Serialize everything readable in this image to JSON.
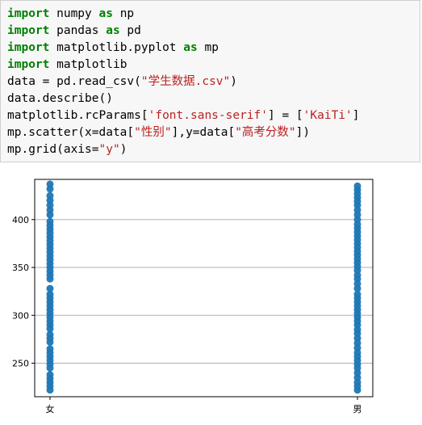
{
  "code_cell": {
    "lines": [
      [
        {
          "t": "import",
          "c": "kw"
        },
        {
          "t": " numpy "
        },
        {
          "t": "as",
          "c": "kw"
        },
        {
          "t": " np"
        }
      ],
      [
        {
          "t": "import",
          "c": "kw"
        },
        {
          "t": " pandas "
        },
        {
          "t": "as",
          "c": "kw"
        },
        {
          "t": " pd"
        }
      ],
      [
        {
          "t": "import",
          "c": "kw"
        },
        {
          "t": " matplotlib.pyplot "
        },
        {
          "t": "as",
          "c": "kw"
        },
        {
          "t": " mp"
        }
      ],
      [
        {
          "t": "import",
          "c": "kw"
        },
        {
          "t": " matplotlib"
        }
      ],
      [
        {
          "t": "data = pd.read_csv("
        },
        {
          "t": "\"学生数据.csv\"",
          "c": "str"
        },
        {
          "t": ")"
        }
      ],
      [
        {
          "t": "data.describe()"
        }
      ],
      [
        {
          "t": "matplotlib.rcParams["
        },
        {
          "t": "'font.sans-serif'",
          "c": "str"
        },
        {
          "t": "] = ["
        },
        {
          "t": "'KaiTi'",
          "c": "str"
        },
        {
          "t": "]"
        }
      ],
      [
        {
          "t": "mp.scatter(x=data["
        },
        {
          "t": "\"性别\"",
          "c": "str"
        },
        {
          "t": "],y=data["
        },
        {
          "t": "\"高考分数\"",
          "c": "str"
        },
        {
          "t": "])"
        }
      ],
      [
        {
          "t": "mp.grid(axis="
        },
        {
          "t": "\"y\"",
          "c": "str"
        },
        {
          "t": ")"
        }
      ]
    ]
  },
  "colors": {
    "keyword": "#008000",
    "string": "#ba2121",
    "marker": "#1f77b4",
    "grid": "#b0b0b0"
  },
  "chart_data": {
    "type": "scatter",
    "categories": [
      "女",
      "男"
    ],
    "ylim": [
      215,
      442
    ],
    "yticks": [
      250,
      300,
      350,
      400
    ],
    "grid": "y",
    "series": [
      {
        "x": "女",
        "values": [
          437,
          432,
          425,
          420,
          415,
          410,
          405,
          398,
          394,
          390,
          386,
          382,
          378,
          374,
          370,
          366,
          362,
          358,
          354,
          350,
          346,
          342,
          338,
          328,
          322,
          318,
          314,
          310,
          306,
          302,
          298,
          294,
          290,
          286,
          280,
          276,
          272,
          265,
          261,
          257,
          253,
          249,
          245,
          238,
          234,
          230,
          226,
          222
        ]
      },
      {
        "x": "男",
        "values": [
          435,
          431,
          427,
          423,
          419,
          415,
          410,
          405,
          400,
          395,
          391,
          387,
          383,
          379,
          375,
          371,
          367,
          363,
          359,
          355,
          351,
          347,
          342,
          338,
          333,
          328,
          322,
          318,
          314,
          310,
          306,
          302,
          298,
          294,
          290,
          285,
          281,
          276,
          271,
          266,
          261,
          257,
          253,
          249,
          245,
          240,
          235,
          230,
          226,
          222
        ]
      }
    ]
  }
}
